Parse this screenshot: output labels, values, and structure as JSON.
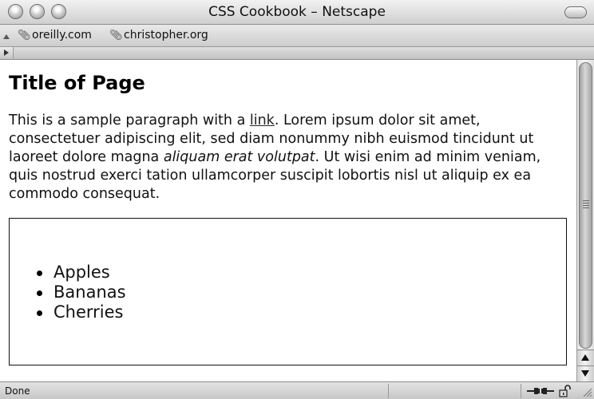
{
  "window": {
    "title": "CSS Cookbook – Netscape"
  },
  "bookmarks": [
    {
      "label": "oreilly.com"
    },
    {
      "label": "christopher.org"
    }
  ],
  "page": {
    "title": "Title of Page",
    "para_before_link": "This is a sample paragraph with a ",
    "link_text": "link",
    "para_after_link": ". Lorem ipsum dolor sit amet, consectetuer adipiscing elit, sed diam nonummy nibh euismod tincidunt ut laoreet dolore magna ",
    "para_emphasis": "aliquam erat volutpat",
    "para_end": ". Ut wisi enim ad minim veniam, quis nostrud exerci tation ullamcorper suscipit lobortis nisl ut aliquip ex ea commodo consequat.",
    "list_items": [
      "Apples",
      "Bananas",
      "Cherries"
    ]
  },
  "status": {
    "text": "Done"
  },
  "icons": {
    "bookmark": "bookmark-icon",
    "connection": "connection-icon",
    "security": "unlocked-padlock-icon"
  },
  "colors": {
    "text": "#111111",
    "page_bg": "#ffffff",
    "chrome": "#d4d4d4"
  }
}
